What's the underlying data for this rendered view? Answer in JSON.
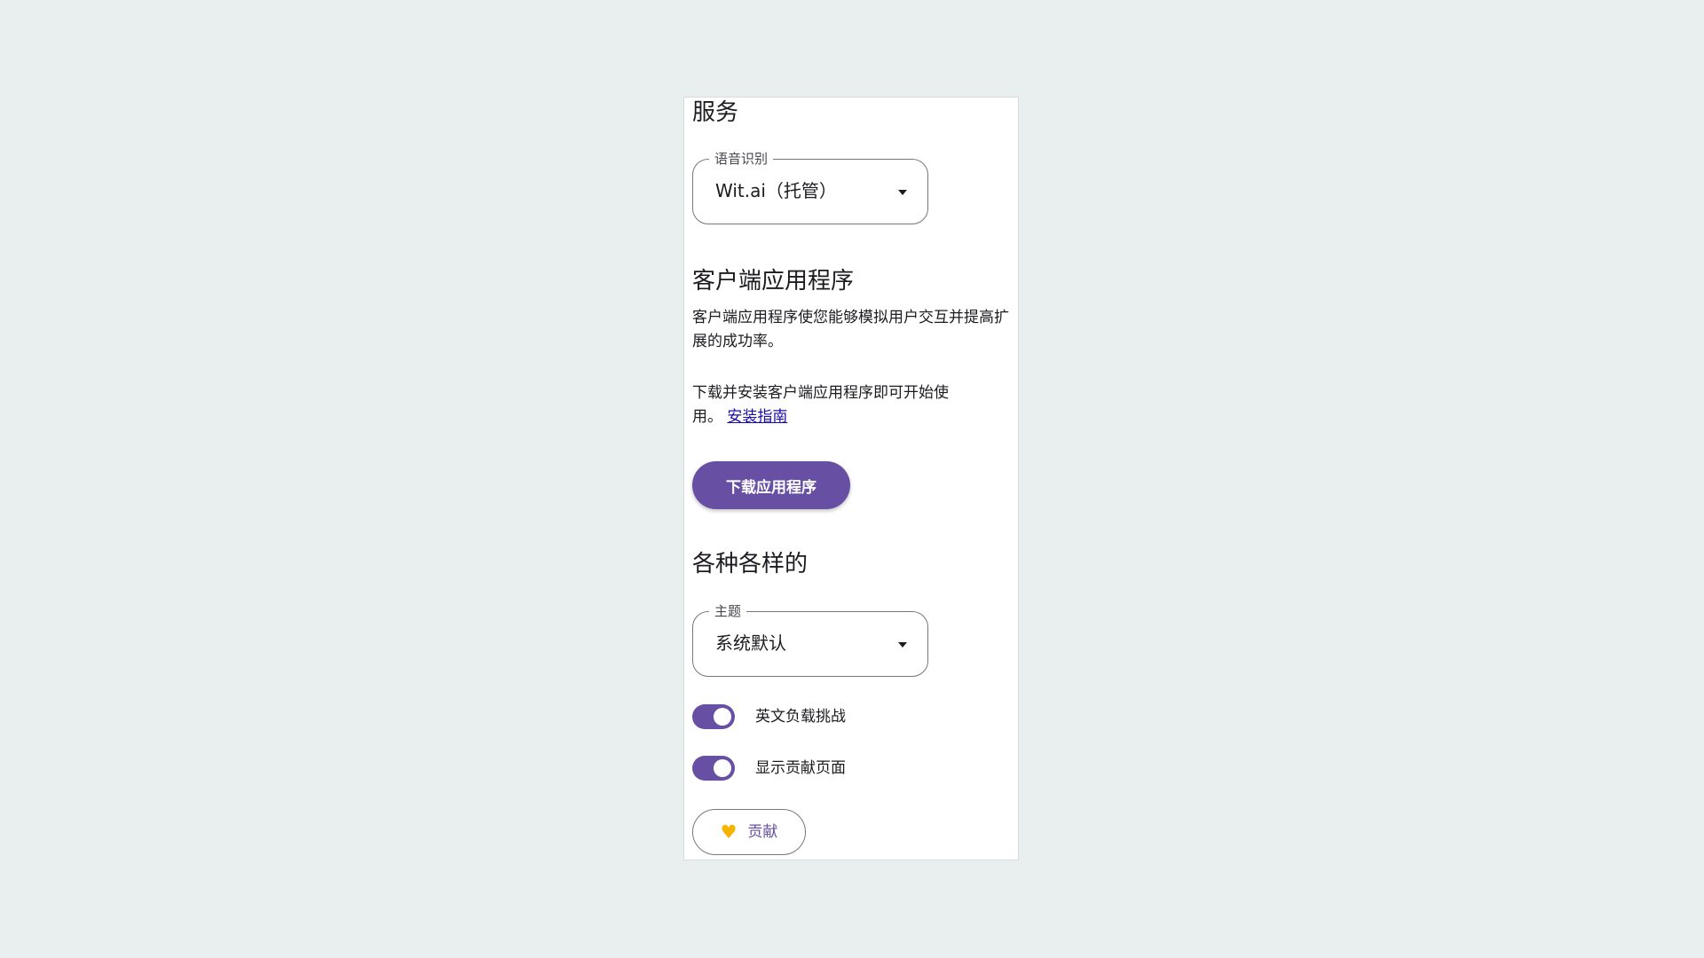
{
  "services": {
    "title": "服务",
    "speech": {
      "label": "语音识别",
      "value": "Wit.ai（托管）",
      "arrow_icon": "arrow-drop-down-icon"
    }
  },
  "client_app": {
    "title": "客户端应用程序",
    "description": "客户端应用程序使您能够模拟用户交互并提高扩展的成功率。",
    "install_text": "下载并安装客户端应用程序即可开始使用。",
    "install_link": "安装指南",
    "download_button": "下载应用程序"
  },
  "misc": {
    "title": "各种各样的",
    "theme": {
      "label": "主题",
      "value": "系统默认",
      "arrow_icon": "arrow-drop-down-icon"
    },
    "toggles": [
      {
        "label": "英文负载挑战",
        "on": true
      },
      {
        "label": "显示贡献页面",
        "on": true
      }
    ],
    "contribute_button": "贡献",
    "contribute_icon": "heart-icon"
  },
  "colors": {
    "primary": "#6750a4",
    "heart": "#f6b400",
    "link": "#1a0dab",
    "background": "#e9eeef"
  }
}
